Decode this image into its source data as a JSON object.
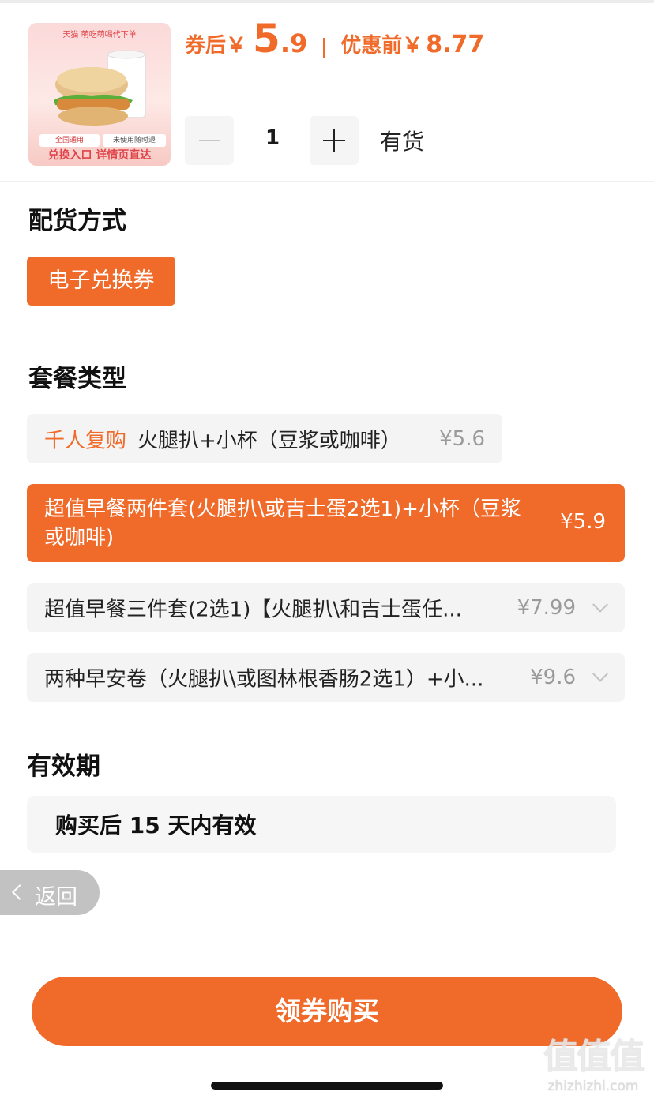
{
  "product": {
    "image_brand_text": "天猫 萌吃萌喝代下单",
    "image_tag_1": "全国通用",
    "image_tag_2": "未使用随时退",
    "image_bottom_text": "兑换入口 详情页直达"
  },
  "price": {
    "after_coupon_label": "券后￥",
    "after_coupon_int": "5",
    "after_coupon_dec": ".9",
    "before_discount_label": "优惠前￥",
    "before_discount_value": "8.77"
  },
  "quantity": {
    "value": "1",
    "stock_status": "有货"
  },
  "delivery": {
    "title": "配货方式",
    "option": "电子兑换券"
  },
  "package": {
    "title": "套餐类型",
    "options": [
      {
        "highlight": "千人复购",
        "label": "火腿扒+小杯（豆浆或咖啡）",
        "price": "¥5.6",
        "selected": false
      },
      {
        "label": "超值早餐两件套(火腿扒\\或吉士蛋2选1)+小杯（豆浆或咖啡)",
        "price": "¥5.9",
        "selected": true
      },
      {
        "label": "超值早餐三件套(2选1)【火腿扒\\和吉士蛋任...",
        "price": "¥7.99",
        "selected": false
      },
      {
        "label": "两种早安卷（火腿扒\\或图林根香肠2选1）+小...",
        "price": "¥9.6",
        "selected": false
      }
    ]
  },
  "validity": {
    "title": "有效期",
    "text": "购买后 15 天内有效"
  },
  "back": {
    "label": "返回"
  },
  "buy": {
    "label": "领券购买"
  },
  "watermark": {
    "logo": "值值值",
    "url": "zhizhizhi.com"
  },
  "colors": {
    "accent": "#f06a2a",
    "option_bg": "#f4f4f4",
    "back_bg": "#c2c2c2"
  }
}
